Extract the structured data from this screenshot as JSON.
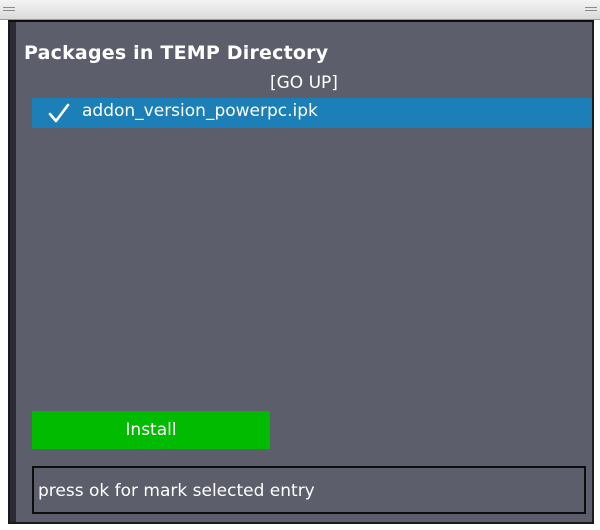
{
  "window": {
    "title": "Packages in TEMP Directory",
    "go_up_label": "[GO UP]"
  },
  "packages": [
    {
      "name": "addon_version_powerpc.ipk",
      "marked": true,
      "selected": true
    }
  ],
  "icons": {
    "mark": "checkmark-icon"
  },
  "actions": {
    "install_label": "Install"
  },
  "status": {
    "message": "press ok for mark selected entry"
  },
  "colors": {
    "background": "#5c5e6b",
    "selection": "#1c7fb8",
    "install_button": "#00bb00",
    "text": "#ffffff"
  }
}
